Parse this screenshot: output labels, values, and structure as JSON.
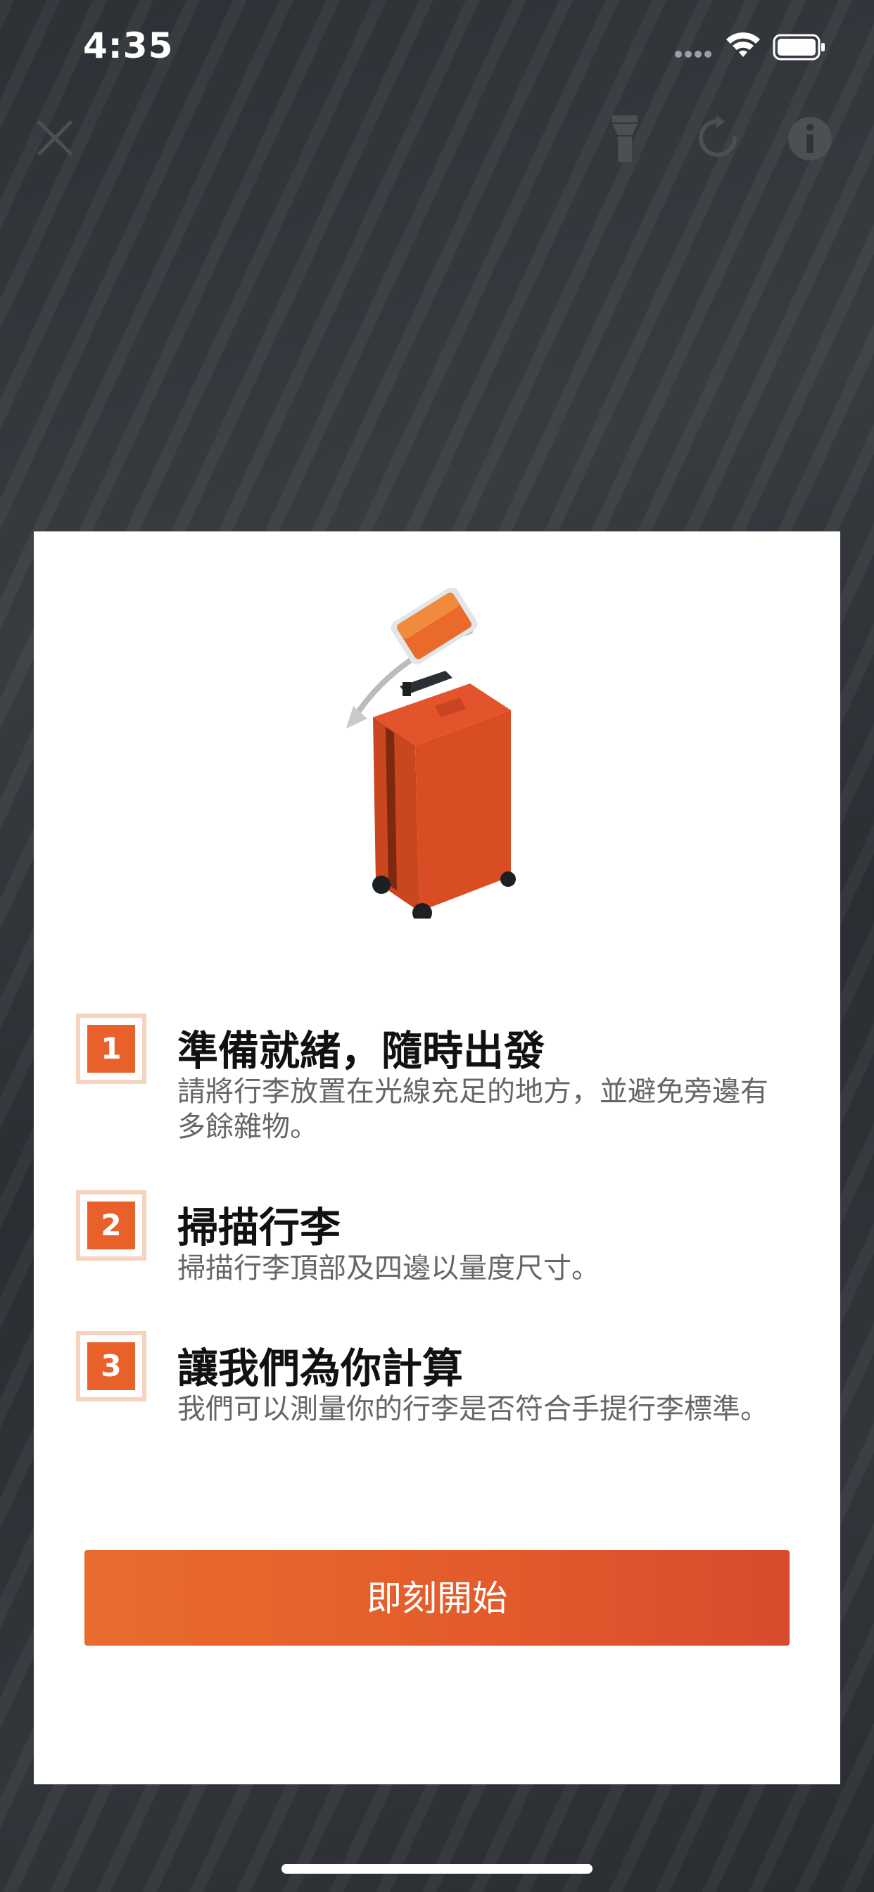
{
  "status_bar": {
    "time": "4:35",
    "icons": [
      "signal-dots-icon",
      "wifi-icon",
      "battery-icon"
    ]
  },
  "toolbar": {
    "icons": [
      "close-icon",
      "flashlight-icon",
      "refresh-icon",
      "info-icon"
    ]
  },
  "modal": {
    "illustration": "suitcase-scan-illustration",
    "steps": [
      {
        "number": "1",
        "title": "準備就緒，隨時出發",
        "description": "請將行李放置在光線充足的地方，並避免旁邊有多餘雜物。"
      },
      {
        "number": "2",
        "title": "掃描行李",
        "description": "掃描行李頂部及四邊以量度尺寸。"
      },
      {
        "number": "3",
        "title": "讓我們為你計算",
        "description": "我們可以測量你的行李是否符合手提行李標準。"
      }
    ],
    "start_button_label": "即刻開始"
  },
  "colors": {
    "accent": "#e8612b",
    "badge_border": "#f6d3bc",
    "button_gradient_start": "#ea6b2e",
    "button_gradient_end": "#d84b2c"
  }
}
